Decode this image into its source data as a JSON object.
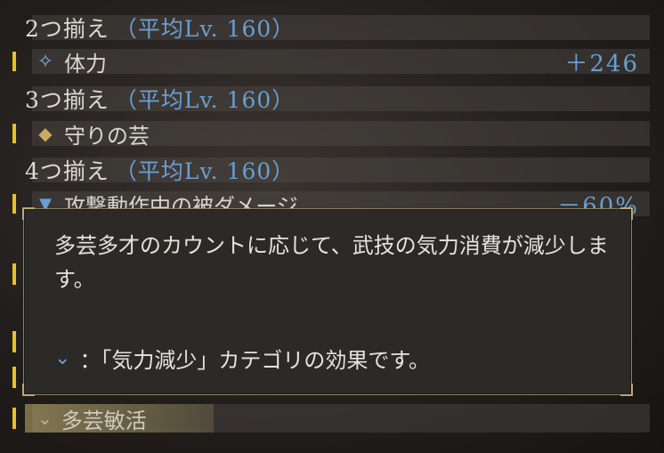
{
  "sets": [
    {
      "title": "2つ揃え",
      "level": "（平均Lv. 160）",
      "effect": {
        "icon": "sparkle-icon",
        "label": "体力",
        "value": "＋246"
      }
    },
    {
      "title": "3つ揃え",
      "level": "（平均Lv. 160）",
      "effect": {
        "icon": "diamond-icon",
        "label": "守りの芸",
        "value": ""
      }
    },
    {
      "title": "4つ揃え",
      "level": "（平均Lv. 160）",
      "effect": {
        "icon": "triangle-down-icon",
        "label": "攻撃動作中の被ダメージ",
        "value": "－60%"
      }
    }
  ],
  "tooltip": {
    "description": "多芸多才のカウントに応じて、武技の気力消費が減少します。",
    "note": "：「気力減少」カテゴリの効果です。",
    "note_icon": "chevron-down-icon"
  },
  "bottom_tag": {
    "label": "多芸敏活",
    "icon": "chevron-down-icon"
  },
  "colors": {
    "accent_blue": "#6a9ed2",
    "bar_yellow": "#e8c21e"
  }
}
